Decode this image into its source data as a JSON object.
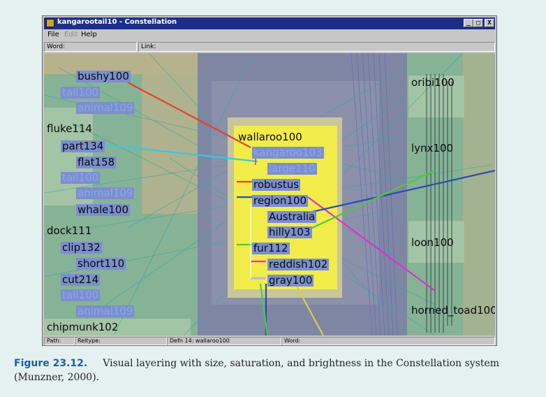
{
  "window": {
    "title": "kangarootail10 - Constellation",
    "controls": {
      "minimize": "_",
      "maximize": "□",
      "close": "X"
    },
    "menu": [
      {
        "label": "File",
        "enabled": true
      },
      {
        "label": "Edit",
        "enabled": false
      },
      {
        "label": "Help",
        "enabled": true
      }
    ],
    "fields": {
      "word_label": "Word:",
      "link_label": "Link:"
    }
  },
  "canvas": {
    "left_nodes": [
      {
        "id": "bushy",
        "label": "bushy100",
        "style": "strong-hi"
      },
      {
        "id": "tail1",
        "label": "tail100",
        "style": "faded"
      },
      {
        "id": "animal1",
        "label": "animal109",
        "style": "faded"
      },
      {
        "id": "fluke",
        "label": "fluke114",
        "style": "plain"
      },
      {
        "id": "part",
        "label": "part134",
        "style": "strong-hi"
      },
      {
        "id": "flat",
        "label": "flat158",
        "style": "strong-hi"
      },
      {
        "id": "tail2",
        "label": "tail100",
        "style": "faded"
      },
      {
        "id": "animal2",
        "label": "animal109",
        "style": "faded"
      },
      {
        "id": "whale",
        "label": "whale100",
        "style": "strong-hi"
      },
      {
        "id": "dock",
        "label": "dock111",
        "style": "plain"
      },
      {
        "id": "clip",
        "label": "clip132",
        "style": "strong-hi"
      },
      {
        "id": "short",
        "label": "short110",
        "style": "strong-hi"
      },
      {
        "id": "cut",
        "label": "cut214",
        "style": "strong-hi"
      },
      {
        "id": "tail3",
        "label": "tail100",
        "style": "faded"
      },
      {
        "id": "animal3",
        "label": "animal109",
        "style": "faded"
      },
      {
        "id": "chipmunk",
        "label": "chipmunk102",
        "style": "plain"
      }
    ],
    "center_nodes": [
      {
        "id": "wallaroo",
        "label": "wallaroo100",
        "style": "plain"
      },
      {
        "id": "kangaroo",
        "label": "kangaroo103",
        "style": "faded"
      },
      {
        "id": "large",
        "label": "large110",
        "style": "faded"
      },
      {
        "id": "robustus",
        "label": "robustus",
        "style": "strong-hi"
      },
      {
        "id": "region",
        "label": "region100",
        "style": "strong-hi"
      },
      {
        "id": "australia",
        "label": "Australia",
        "style": "strong-hi"
      },
      {
        "id": "hilly",
        "label": "hilly103",
        "style": "strong-hi"
      },
      {
        "id": "fur",
        "label": "fur112",
        "style": "strong-hi"
      },
      {
        "id": "reddish",
        "label": "reddish102",
        "style": "strong-hi"
      },
      {
        "id": "gray",
        "label": "gray100",
        "style": "strong-hi"
      }
    ],
    "right_nodes": [
      {
        "id": "oribi",
        "label": "oribi100"
      },
      {
        "id": "lynx",
        "label": "lynx100"
      },
      {
        "id": "loon",
        "label": "loon100"
      },
      {
        "id": "horned",
        "label": "horned_toad100"
      }
    ],
    "colors": {
      "background": "#7f86a3",
      "left_panel": "#86b296",
      "right_panel": "#86b296",
      "tan": "#b8b28c",
      "outer_box": "#c9c69a",
      "inner_box": "#f2ec4a",
      "node_highlight": "#7b8fcf",
      "faded_text": "#8ba6e6",
      "red": "#e8402a",
      "cyan": "#3ac8e0",
      "blue": "#2a4cb0",
      "green": "#4ccc3a",
      "magenta": "#e030c8"
    }
  },
  "status": {
    "path_label": "Path:",
    "reltype_label": "Reltype:",
    "defn_text": "Defn 14: wallaroo100",
    "word_label": "Word:"
  },
  "caption": {
    "figure_label": "Figure 23.12.",
    "text": "Visual layering with size, saturation, and brightness in the Constellation system (Munzner, 2000)."
  }
}
